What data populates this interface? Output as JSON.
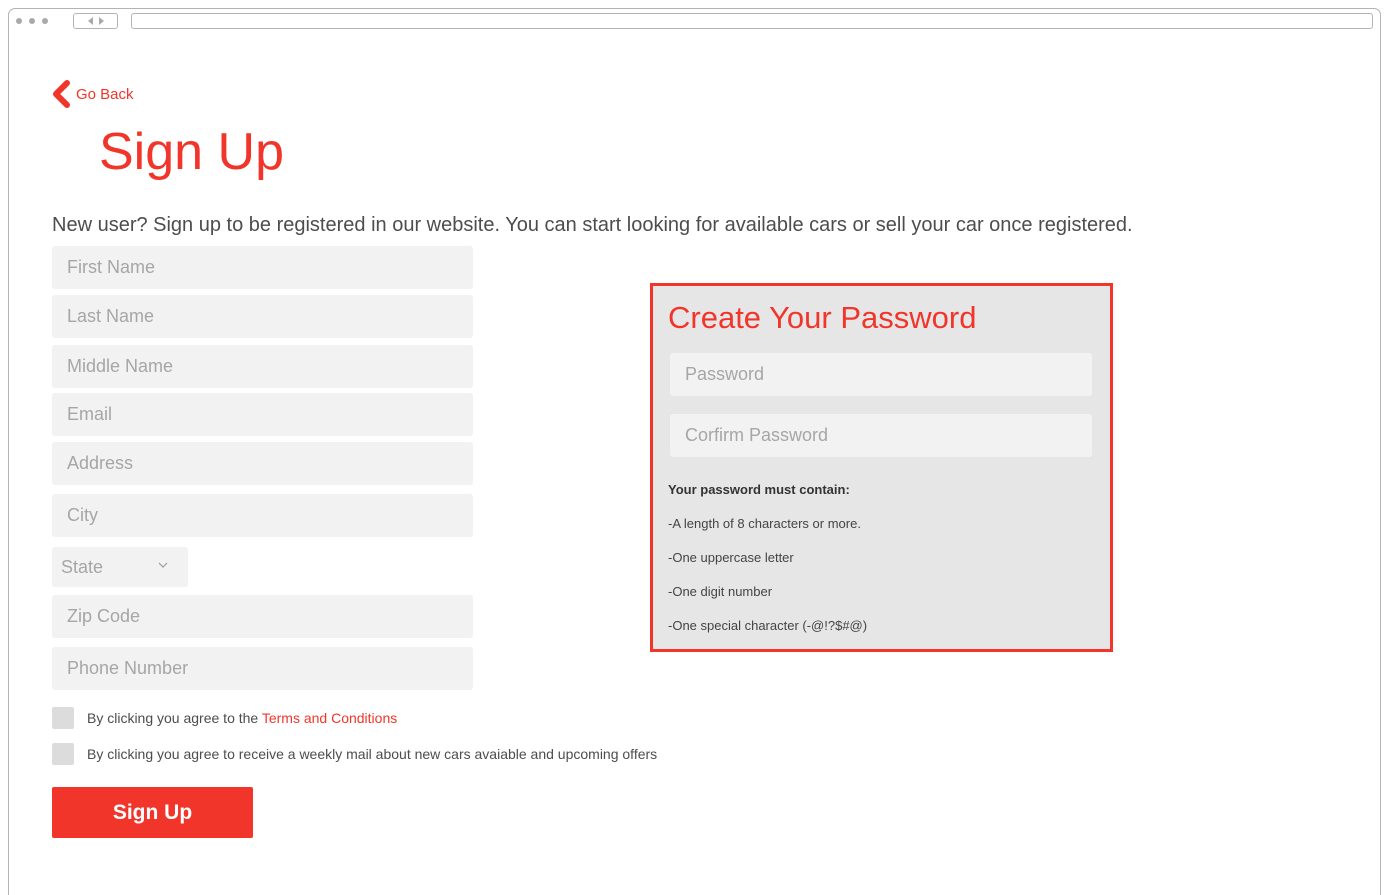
{
  "nav": {
    "back_label": "Go Back"
  },
  "page": {
    "title": "Sign Up",
    "intro": "New user? Sign up to be registered in our website. You can start looking for available cars or sell your car once registered."
  },
  "form": {
    "first_name_placeholder": "First Name",
    "last_name_placeholder": "Last Name",
    "middle_name_placeholder": "Middle Name",
    "email_placeholder": "Email",
    "address_placeholder": "Address",
    "city_placeholder": "City",
    "state_label": "State",
    "zip_placeholder": "Zip Code",
    "phone_placeholder": "Phone Number"
  },
  "agreements": {
    "terms_prefix": "By clicking you agree to the ",
    "terms_link": "Terms and Conditions",
    "mail_text": "By clicking you agree to receive a weekly mail about new cars avaiable and upcoming offers"
  },
  "submit_label": "Sign Up",
  "password_panel": {
    "title": "Create Your Password",
    "password_placeholder": "Password",
    "confirm_placeholder": "Corfirm Password",
    "requirements_heading": "Your password must contain:",
    "requirements": [
      "-A length of 8 characters or more.",
      "-One uppercase letter",
      "-One digit number",
      "-One special character (-@!?$#@)"
    ]
  },
  "colors": {
    "accent": "#f2352a",
    "field_bg": "#f2f2f2",
    "panel_bg": "#e6e6e6"
  },
  "icons": {
    "back": "chevron-left-icon",
    "state_dropdown": "chevron-down-icon"
  }
}
